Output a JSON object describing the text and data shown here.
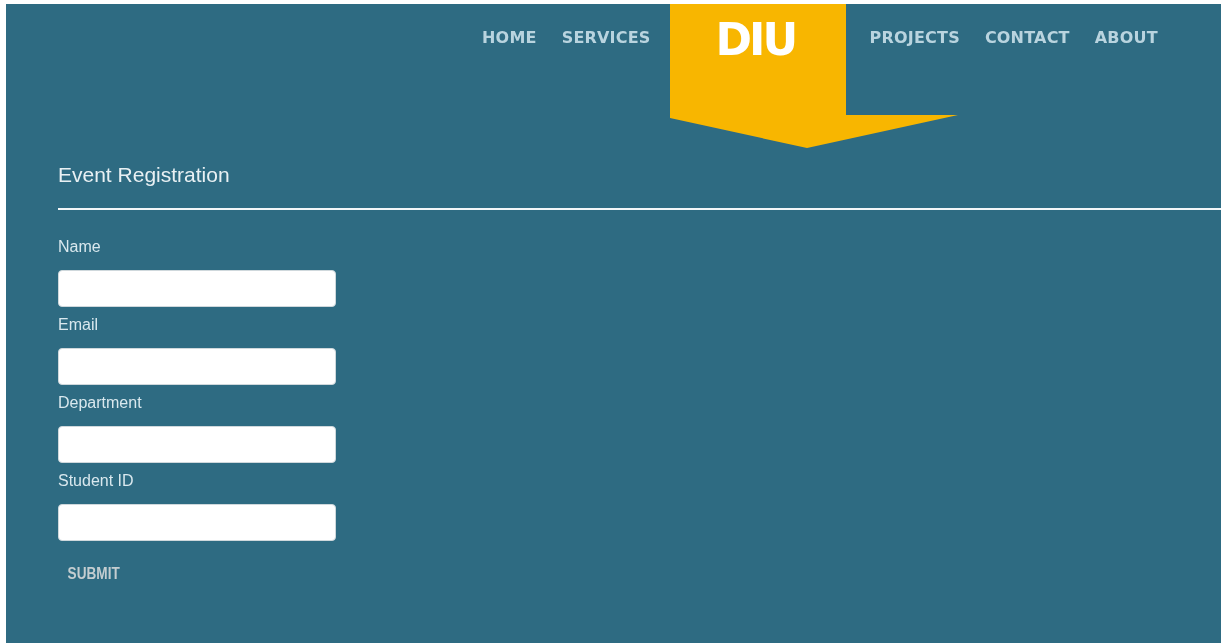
{
  "nav": [
    {
      "kind": "link",
      "label": "HOME"
    },
    {
      "kind": "link",
      "label": "SERVICES"
    },
    {
      "kind": "logo",
      "label": "DIU"
    },
    {
      "kind": "link",
      "label": "PROJECTS"
    },
    {
      "kind": "link",
      "label": "CONTACT"
    },
    {
      "kind": "link",
      "label": "ABOUT"
    }
  ],
  "form": {
    "title": "Event Registration",
    "fields": [
      {
        "label": "Name"
      },
      {
        "label": "Email"
      },
      {
        "label": "Department"
      },
      {
        "label": "Student ID"
      }
    ],
    "submit": "SUBMIT"
  }
}
